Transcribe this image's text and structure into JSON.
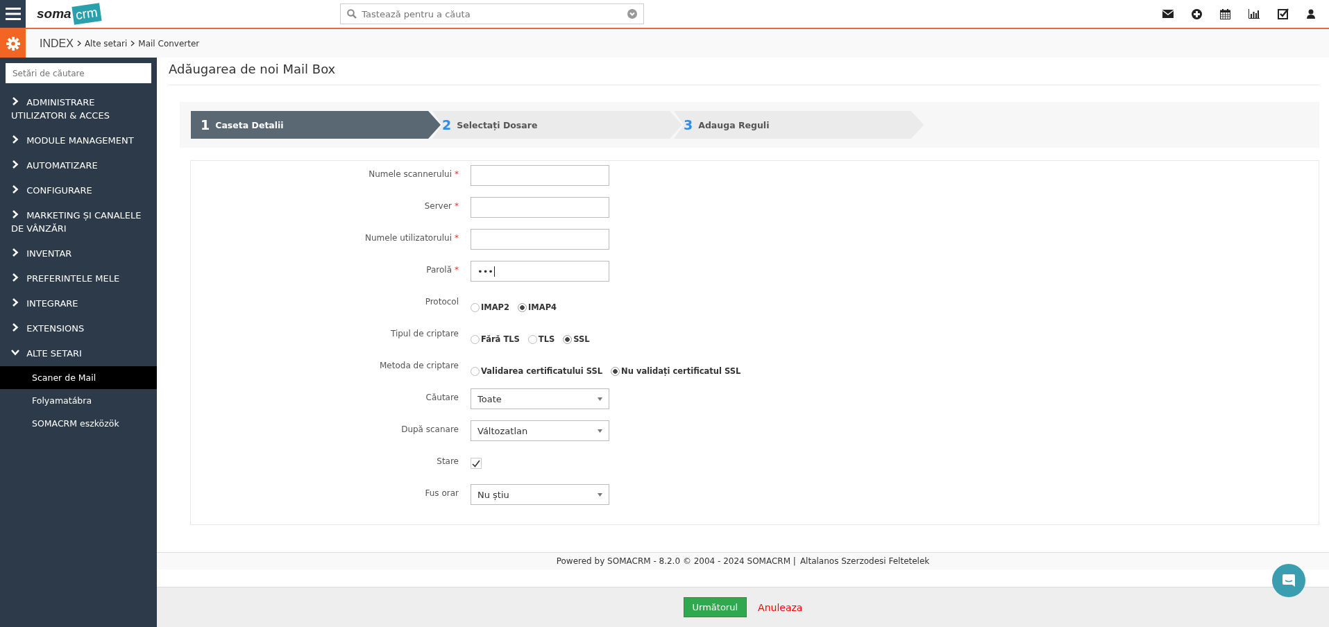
{
  "header": {
    "logo_left": "soma",
    "logo_right": "crm",
    "search": {
      "placeholder": "Tastează pentru a căuta"
    }
  },
  "breadcrumb": [
    "INDEX",
    "Alte setari",
    "Mail Converter"
  ],
  "sidebar": {
    "search": {
      "placeholder": "Setări de căutare"
    },
    "items": [
      {
        "label": "ADMINISTRARE UTILIZATORI & ACCES",
        "expanded": false
      },
      {
        "label": "MODULE MANAGEMENT",
        "expanded": false
      },
      {
        "label": "AUTOMATIZARE",
        "expanded": false
      },
      {
        "label": "CONFIGURARE",
        "expanded": false
      },
      {
        "label": "MARKETING ȘI CANALELE DE VÂNZĂRI",
        "expanded": false
      },
      {
        "label": "INVENTAR",
        "expanded": false
      },
      {
        "label": "PREFERINTELE MELE",
        "expanded": false
      },
      {
        "label": "INTEGRARE",
        "expanded": false
      },
      {
        "label": "EXTENSIONS",
        "expanded": false
      },
      {
        "label": "ALTE SETARI",
        "expanded": true,
        "children": [
          {
            "label": "Scaner de Mail",
            "selected": true
          },
          {
            "label": "Folyamatábra",
            "selected": false
          },
          {
            "label": "SOMACRM eszközök",
            "selected": false
          }
        ]
      }
    ]
  },
  "page_title": "Adăugarea de noi Mail Box",
  "steps": [
    {
      "number": "1",
      "label": "Caseta Detalii",
      "selected": true
    },
    {
      "number": "2",
      "label": "Selectați Dosare",
      "selected": false
    },
    {
      "number": "3",
      "label": "Adauga Reguli",
      "selected": false
    }
  ],
  "form": [
    {
      "kind": "text",
      "label": "Numele scannerului",
      "required": true
    },
    {
      "kind": "text",
      "label": "Server",
      "required": true
    },
    {
      "kind": "text",
      "label": "Numele utilizatorului",
      "required": true
    },
    {
      "kind": "text",
      "label": "Parolă",
      "required": true,
      "value": "•••"
    },
    {
      "kind": "radio",
      "label": "Protocol",
      "options": [
        {
          "label": "IMAP2",
          "selected": false
        },
        {
          "label": "IMAP4",
          "selected": true
        }
      ]
    },
    {
      "kind": "radio",
      "label": "Tipul de criptare",
      "options": [
        {
          "label": "Fără TLS",
          "selected": false
        },
        {
          "label": "TLS",
          "selected": false
        },
        {
          "label": "SSL",
          "selected": true
        }
      ]
    },
    {
      "kind": "radio",
      "label": "Metoda de criptare",
      "options": [
        {
          "label": "Validarea certificatului SSL",
          "selected": false
        },
        {
          "label": "Nu validați certificatul SSL",
          "selected": true
        }
      ]
    },
    {
      "kind": "select",
      "label": "Căutare",
      "value": "Toate"
    },
    {
      "kind": "select",
      "label": "După scanare",
      "value": "Változatlan"
    },
    {
      "kind": "checkbox",
      "label": "Stare",
      "checked": true
    },
    {
      "kind": "select",
      "label": "Fus orar",
      "value": "Nu știu"
    }
  ],
  "required_mark": "*",
  "footer": {
    "text": "Powered by SOMACRM - 8.2.0  © 2004 - 2024  SOMACRM |",
    "link": "Altalanos Szerzodesi Feltetelek"
  },
  "actions": {
    "next": "Următorul",
    "cancel": "Anuleaza"
  }
}
